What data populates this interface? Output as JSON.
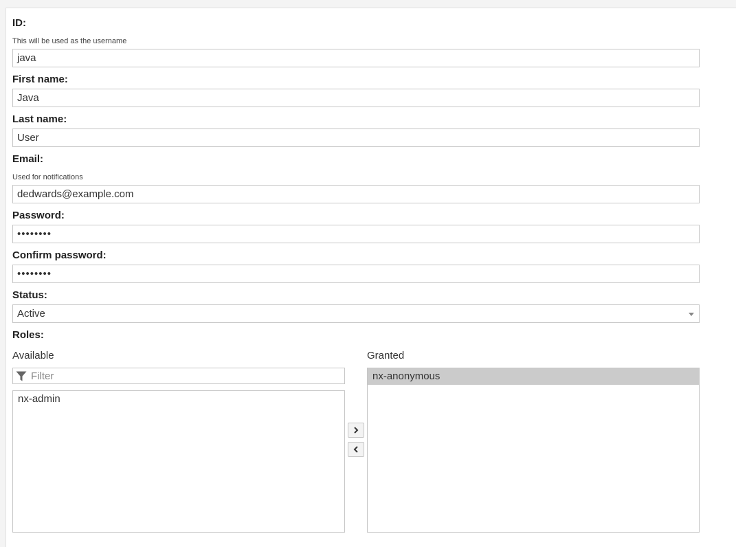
{
  "form": {
    "id": {
      "label": "ID:",
      "help": "This will be used as the username",
      "value": "java"
    },
    "first_name": {
      "label": "First name:",
      "value": "Java"
    },
    "last_name": {
      "label": "Last name:",
      "value": "User"
    },
    "email": {
      "label": "Email:",
      "help": "Used for notifications",
      "value": "dedwards@example.com"
    },
    "password": {
      "label": "Password:",
      "value": "••••••••"
    },
    "confirm_password": {
      "label": "Confirm password:",
      "value": "••••••••"
    },
    "status": {
      "label": "Status:",
      "value": "Active"
    },
    "roles": {
      "label": "Roles:",
      "available_label": "Available",
      "granted_label": "Granted",
      "filter_placeholder": "Filter",
      "available": [
        "nx-admin"
      ],
      "granted": [
        "nx-anonymous"
      ]
    }
  },
  "icons": {
    "filter": "filter-icon",
    "dropdown": "chevron-down-icon",
    "move_right": "chevron-right-icon",
    "move_left": "chevron-left-icon"
  }
}
